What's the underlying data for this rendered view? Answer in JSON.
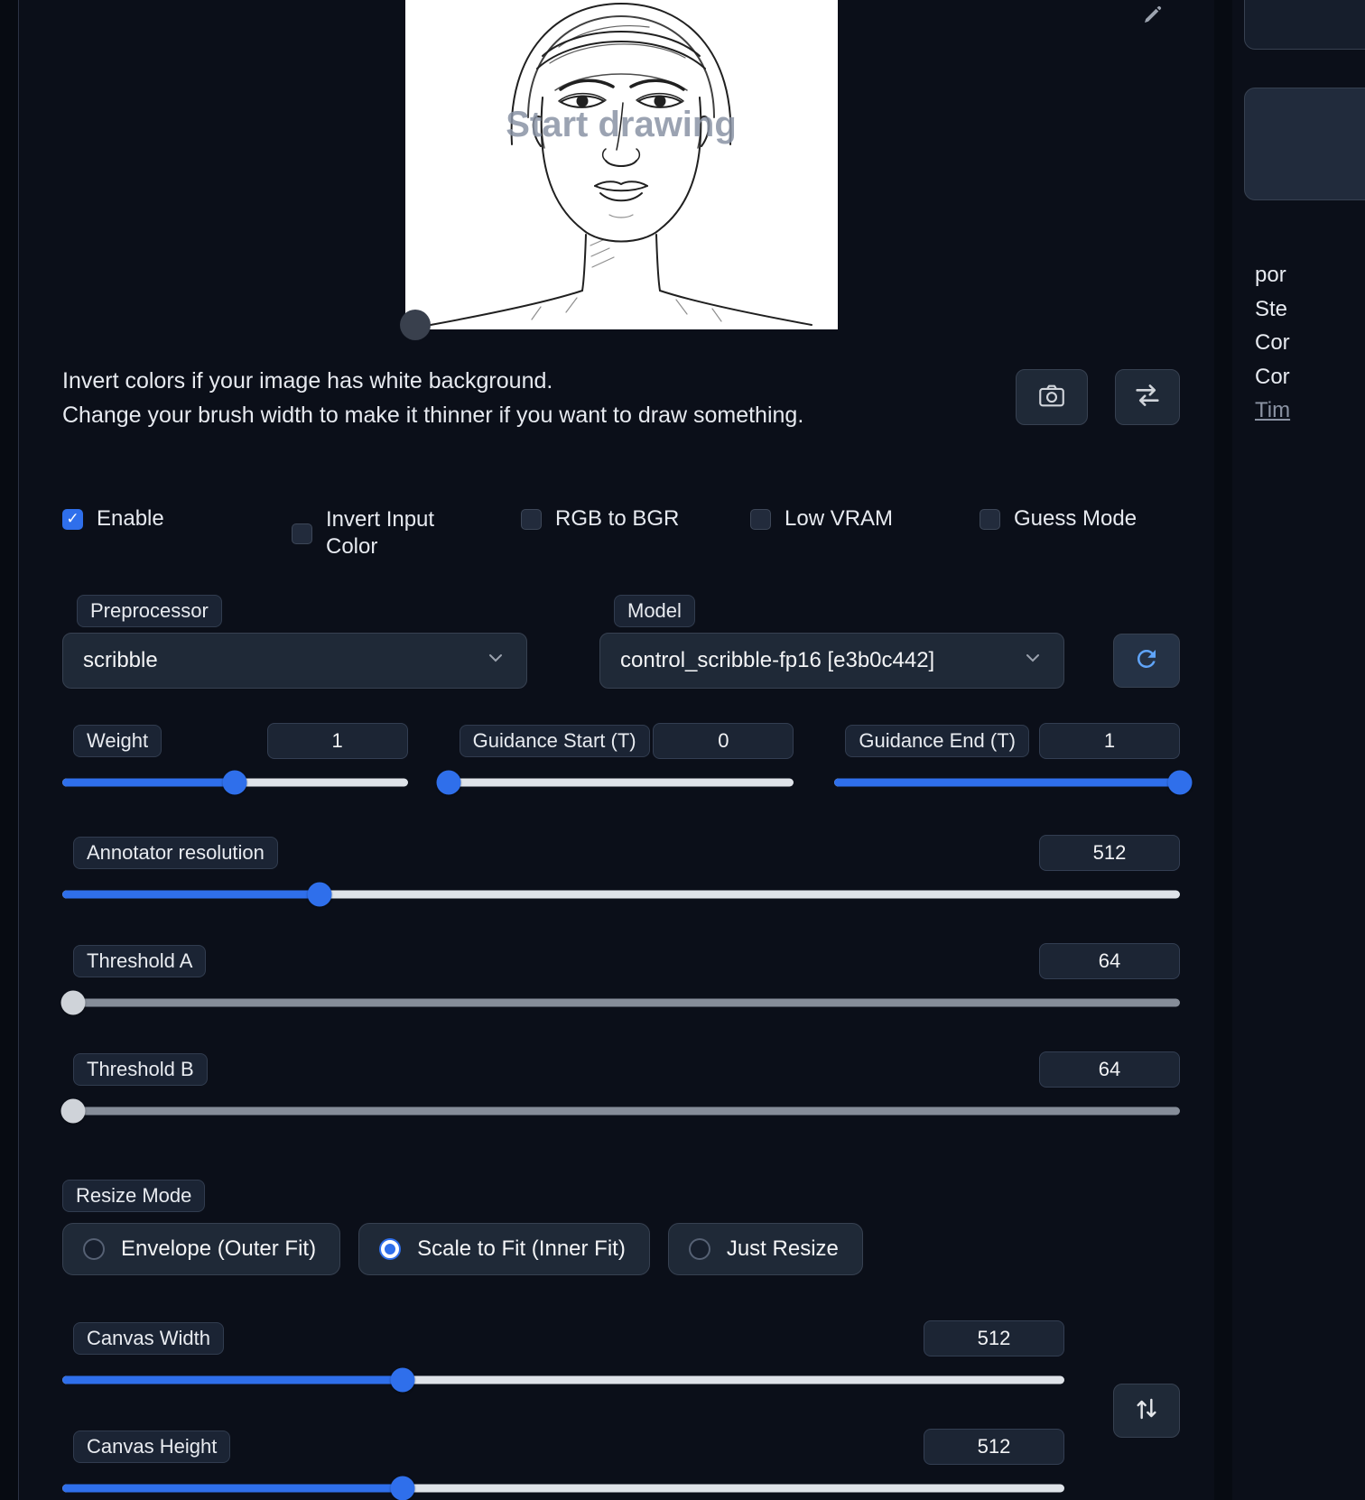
{
  "image_panel": {
    "overlay_text": "Start drawing"
  },
  "info": {
    "line1": "Invert colors if your image has white background.",
    "line2": "Change your brush width to make it thinner if you want to draw something."
  },
  "checkboxes": {
    "enable": {
      "label": "Enable",
      "checked": true
    },
    "invert_input_color": {
      "label": "Invert Input Color",
      "checked": false
    },
    "rgb_to_bgr": {
      "label": "RGB to BGR",
      "checked": false
    },
    "low_vram": {
      "label": "Low VRAM",
      "checked": false
    },
    "guess_mode": {
      "label": "Guess Mode",
      "checked": false
    }
  },
  "dropdowns": {
    "preprocessor": {
      "label": "Preprocessor",
      "value": "scribble"
    },
    "model": {
      "label": "Model",
      "value": "control_scribble-fp16 [e3b0c442]"
    }
  },
  "sliders": {
    "weight": {
      "label": "Weight",
      "value": "1",
      "percent": 50
    },
    "guidance_start": {
      "label": "Guidance Start (T)",
      "value": "0",
      "percent": 0
    },
    "guidance_end": {
      "label": "Guidance End (T)",
      "value": "1",
      "percent": 100
    },
    "annotator_resolution": {
      "label": "Annotator resolution",
      "value": "512",
      "percent": 23
    },
    "threshold_a": {
      "label": "Threshold A",
      "value": "64",
      "percent": 1
    },
    "threshold_b": {
      "label": "Threshold B",
      "value": "64",
      "percent": 1
    },
    "canvas_width": {
      "label": "Canvas Width",
      "value": "512",
      "percent": 34
    },
    "canvas_height": {
      "label": "Canvas Height",
      "value": "512",
      "percent": 34
    }
  },
  "resize_mode": {
    "label": "Resize Mode",
    "options": [
      {
        "label": "Envelope (Outer Fit)",
        "selected": false
      },
      {
        "label": "Scale to Fit (Inner Fit)",
        "selected": true
      },
      {
        "label": "Just Resize",
        "selected": false
      }
    ]
  },
  "sidebar": {
    "items": [
      {
        "text": "por"
      },
      {
        "text": "Ste"
      },
      {
        "text": "Cor"
      },
      {
        "text": "Cor"
      },
      {
        "text": "Tim"
      }
    ]
  },
  "colors": {
    "accent_blue": "#2f6feb",
    "panel_bg": "#1f2937",
    "page_bg": "#0b0f19"
  }
}
